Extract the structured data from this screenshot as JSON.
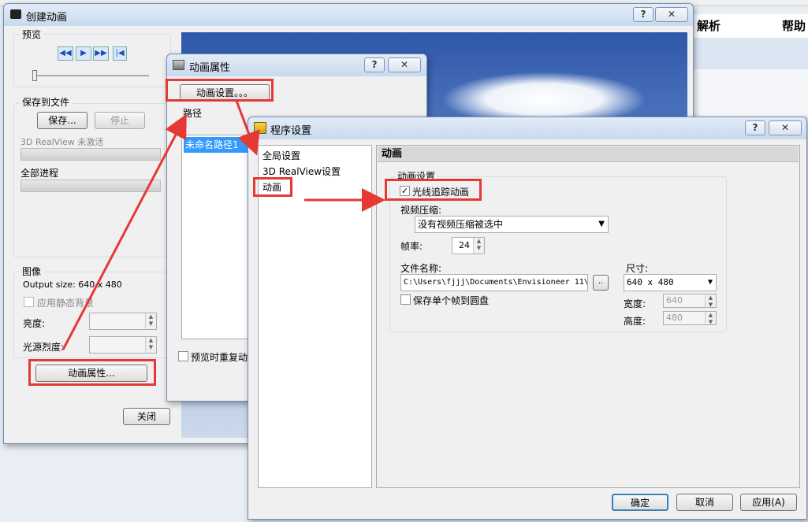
{
  "bg_app": {
    "tabs": [
      "解析",
      "帮助"
    ]
  },
  "create_anim": {
    "title": "创建动画",
    "preview_label": "预览",
    "save_group_label": "保存到文件",
    "save_btn": "保存...",
    "stop_btn": "停止",
    "realview_status": "3D RealView 未激活",
    "all_progress": "全部进程",
    "image_label": "图像",
    "output_size": "Output size: 640 x 480",
    "static_bg": "应用静态背景",
    "brightness": "亮度:",
    "light_intensity": "光源烈度:",
    "anim_props_btn": "动画属性...",
    "close_btn": "关闭"
  },
  "anim_props": {
    "title": "动画属性",
    "help": "?",
    "settings_btn": "动画设置。。。",
    "path_label": "路径",
    "path_item": "未命名路径1",
    "repeat_preview": "预览时重复动"
  },
  "program_settings": {
    "title": "程序设置",
    "help": "?",
    "tree": [
      "全局设置",
      "3D RealView设置",
      "动画"
    ],
    "section_title": "动画",
    "group_title": "动画设置",
    "raytrace": "光线追踪动画",
    "raytrace_checked": true,
    "video_compress_label": "视频压缩:",
    "video_compress_value": "没有视频压缩被选中",
    "framerate_label": "帧率:",
    "framerate_value": "24",
    "filename_label": "文件名称:",
    "filename_value": "C:\\Users\\fjjj\\Documents\\Envisioneer 11\\",
    "browse_btn": "..",
    "save_single_frame": "保存单个帧到圆盘",
    "size_label": "尺寸:",
    "size_value": "640 x 480",
    "width_label": "宽度:",
    "width_value": "640",
    "height_label": "高度:",
    "height_value": "480",
    "ok": "确定",
    "cancel": "取消",
    "apply": "应用(A)"
  },
  "colors": {
    "annotation": "#e53935",
    "sky": "#4a6fb0",
    "selection": "#3399ff"
  }
}
